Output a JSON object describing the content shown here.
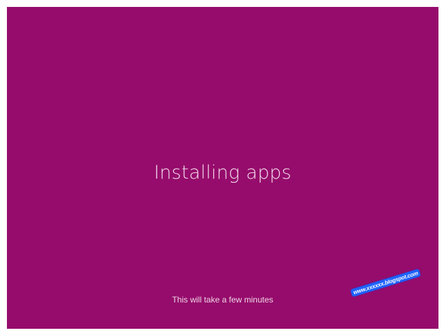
{
  "screen": {
    "title": "Installing apps",
    "subtitle": "This will take a few minutes",
    "background_color": "#960c6c",
    "text_color": "#f2d9ea"
  },
  "watermark": {
    "text": "www.xxxxxx.blogspot.com",
    "color": "#1e62ff"
  }
}
